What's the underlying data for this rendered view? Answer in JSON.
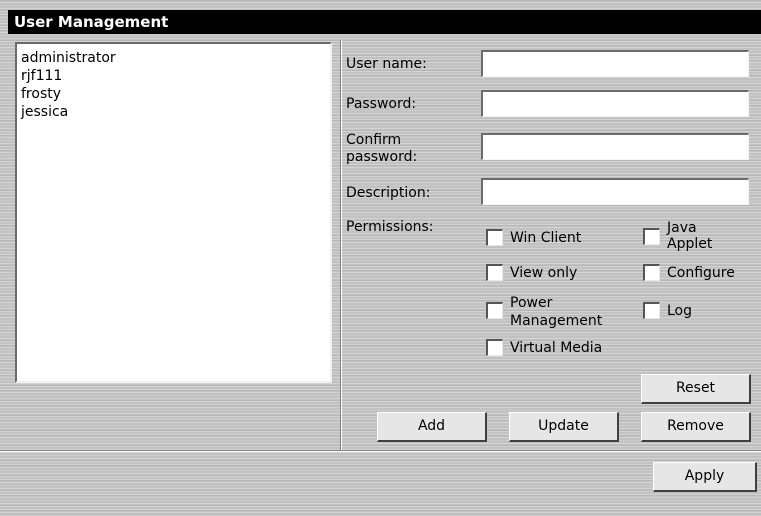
{
  "window": {
    "title": "User Management"
  },
  "users": [
    "administrator",
    "rjf111",
    "frosty",
    "jessica"
  ],
  "form": {
    "username_label": "User name:",
    "username_value": "",
    "password_label": "Password:",
    "password_value": "",
    "confirm_label": "Confirm\npassword:",
    "confirm_value": "",
    "description_label": "Description:",
    "description_value": "",
    "permissions_label": "Permissions:"
  },
  "permissions": {
    "win_client": {
      "label": "Win Client",
      "checked": false
    },
    "java_applet": {
      "label": "Java\nApplet",
      "checked": false
    },
    "view_only": {
      "label": "View only",
      "checked": false
    },
    "configure": {
      "label": "Configure",
      "checked": false
    },
    "power_management": {
      "label": "Power\nManagement",
      "checked": false
    },
    "log": {
      "label": "Log",
      "checked": false
    },
    "virtual_media": {
      "label": "Virtual Media",
      "checked": false
    }
  },
  "buttons": {
    "reset": "Reset",
    "add": "Add",
    "update": "Update",
    "remove": "Remove",
    "apply": "Apply"
  }
}
